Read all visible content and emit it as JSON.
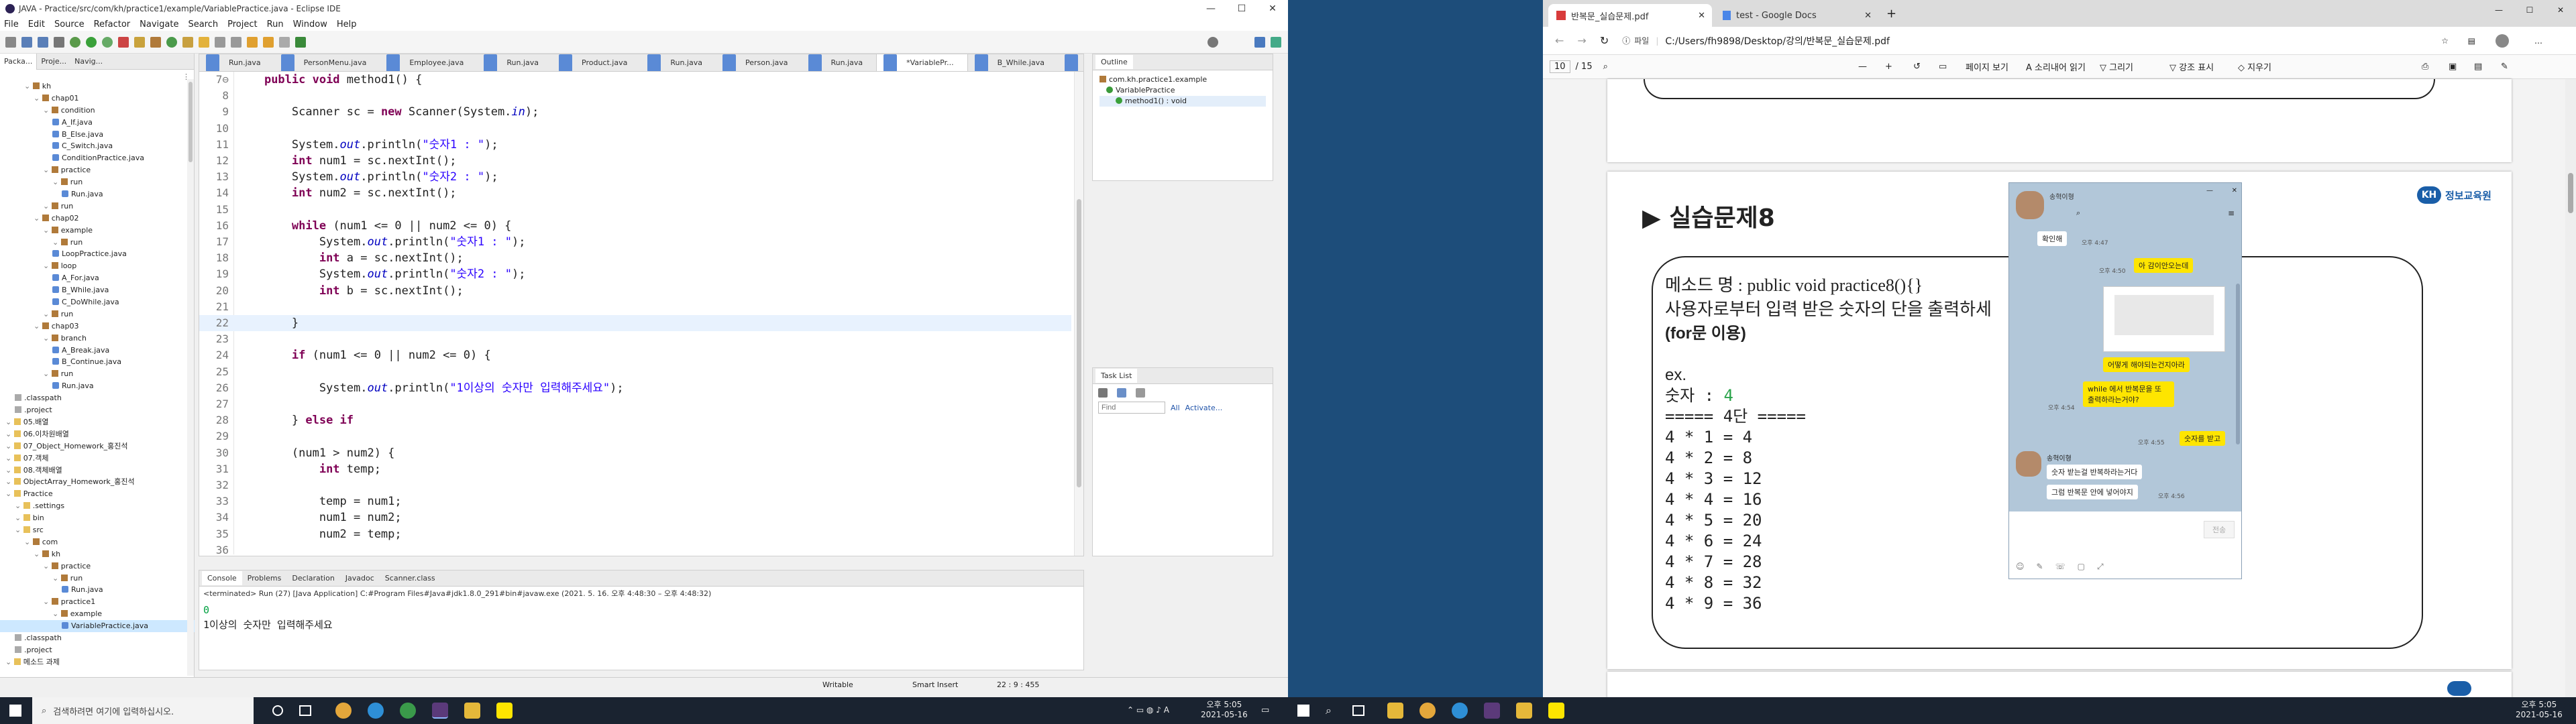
{
  "eclipse": {
    "title": "JAVA - Practice/src/com/kh/practice1/example/VariablePractice.java - Eclipse IDE",
    "window_buttons": {
      "minimize": "—",
      "maximize": "☐",
      "close": "✕"
    },
    "menu": [
      "File",
      "Edit",
      "Source",
      "Refactor",
      "Navigate",
      "Search",
      "Project",
      "Run",
      "Window",
      "Help"
    ],
    "view_tabs": [
      "Packa...",
      "Proje...",
      "Navig..."
    ],
    "tree": [
      {
        "t": "kh",
        "lvl": 2,
        "k": "p"
      },
      {
        "t": "chap01",
        "lvl": 3,
        "k": "p"
      },
      {
        "t": "condition",
        "lvl": 4,
        "k": "p"
      },
      {
        "t": "A_If.java",
        "lvl": 5,
        "k": "j"
      },
      {
        "t": "B_Else.java",
        "lvl": 5,
        "k": "j"
      },
      {
        "t": "C_Switch.java",
        "lvl": 5,
        "k": "j"
      },
      {
        "t": "ConditionPractice.java",
        "lvl": 5,
        "k": "j"
      },
      {
        "t": "practice",
        "lvl": 4,
        "k": "p"
      },
      {
        "t": "run",
        "lvl": 5,
        "k": "p"
      },
      {
        "t": "Run.java",
        "lvl": 6,
        "k": "j"
      },
      {
        "t": "run",
        "lvl": 4,
        "k": "p"
      },
      {
        "t": "chap02",
        "lvl": 3,
        "k": "p"
      },
      {
        "t": "example",
        "lvl": 4,
        "k": "p"
      },
      {
        "t": "run",
        "lvl": 5,
        "k": "p"
      },
      {
        "t": "LoopPractice.java",
        "lvl": 5,
        "k": "j"
      },
      {
        "t": "loop",
        "lvl": 4,
        "k": "p"
      },
      {
        "t": "A_For.java",
        "lvl": 5,
        "k": "j"
      },
      {
        "t": "B_While.java",
        "lvl": 5,
        "k": "j"
      },
      {
        "t": "C_DoWhile.java",
        "lvl": 5,
        "k": "j"
      },
      {
        "t": "run",
        "lvl": 4,
        "k": "p"
      },
      {
        "t": "chap03",
        "lvl": 3,
        "k": "p"
      },
      {
        "t": "branch",
        "lvl": 4,
        "k": "p"
      },
      {
        "t": "A_Break.java",
        "lvl": 5,
        "k": "j"
      },
      {
        "t": "B_Continue.java",
        "lvl": 5,
        "k": "j"
      },
      {
        "t": "run",
        "lvl": 4,
        "k": "p"
      },
      {
        "t": "Run.java",
        "lvl": 5,
        "k": "j"
      },
      {
        "t": ".classpath",
        "lvl": 1,
        "k": "x"
      },
      {
        "t": ".project",
        "lvl": 1,
        "k": "x"
      },
      {
        "t": "05.배열",
        "lvl": 0,
        "k": "f"
      },
      {
        "t": "06.이차원배열",
        "lvl": 0,
        "k": "f"
      },
      {
        "t": "07_Object_Homework_홍진석",
        "lvl": 0,
        "k": "f"
      },
      {
        "t": "07.객체",
        "lvl": 0,
        "k": "f"
      },
      {
        "t": "08.객체배열",
        "lvl": 0,
        "k": "f"
      },
      {
        "t": "ObjectArray_Homework_홍진석",
        "lvl": 0,
        "k": "f"
      },
      {
        "t": "Practice",
        "lvl": 0,
        "k": "f"
      },
      {
        "t": ".settings",
        "lvl": 1,
        "k": "f"
      },
      {
        "t": "bin",
        "lvl": 1,
        "k": "f"
      },
      {
        "t": "src",
        "lvl": 1,
        "k": "f"
      },
      {
        "t": "com",
        "lvl": 2,
        "k": "p"
      },
      {
        "t": "kh",
        "lvl": 3,
        "k": "p"
      },
      {
        "t": "practice",
        "lvl": 4,
        "k": "p"
      },
      {
        "t": "run",
        "lvl": 5,
        "k": "p"
      },
      {
        "t": "Run.java",
        "lvl": 6,
        "k": "j"
      },
      {
        "t": "practice1",
        "lvl": 4,
        "k": "p"
      },
      {
        "t": "example",
        "lvl": 5,
        "k": "p"
      },
      {
        "t": "VariablePractice.java",
        "lvl": 6,
        "k": "j",
        "sel": true
      },
      {
        "t": ".classpath",
        "lvl": 1,
        "k": "x"
      },
      {
        "t": ".project",
        "lvl": 1,
        "k": "x"
      },
      {
        "t": "메소드 과제",
        "lvl": 0,
        "k": "f"
      }
    ],
    "editor_tabs": [
      "Run.java",
      "PersonMenu.java",
      "Employee.java",
      "Run.java",
      "Product.java",
      "Run.java",
      "Person.java",
      "Run.java",
      "*VariablePr...",
      "B_While.java",
      "C_DoWhile.java",
      "»9"
    ],
    "code_lines": [
      {
        "n": "7⊖",
        "h": "    <span class=kw>public void</span> method1() {"
      },
      {
        "n": "8",
        "h": ""
      },
      {
        "n": "9",
        "h": "        Scanner sc = <span class=kw>new</span> Scanner(System.<span class=fi>in</span>);"
      },
      {
        "n": "10",
        "h": ""
      },
      {
        "n": "11",
        "h": "        System.<span class=fi>out</span>.println(<span class=st>\"숫자1 : \"</span>);"
      },
      {
        "n": "12",
        "h": "        <span class=kw>int</span> num1 = sc.nextInt();"
      },
      {
        "n": "13",
        "h": "        System.<span class=fi>out</span>.println(<span class=st>\"숫자2 : \"</span>);"
      },
      {
        "n": "14",
        "h": "        <span class=kw>int</span> num2 = sc.nextInt();"
      },
      {
        "n": "15",
        "h": ""
      },
      {
        "n": "16",
        "h": "        <span class=kw>while</span> (num1 &lt;= 0 || num2 &lt;= 0) {"
      },
      {
        "n": "17",
        "h": "            System.<span class=fi>out</span>.println(<span class=st>\"숫자1 : \"</span>);"
      },
      {
        "n": "18",
        "h": "            <span class=kw>int</span> a = sc.nextInt();"
      },
      {
        "n": "19",
        "h": "            System.<span class=fi>out</span>.println(<span class=st>\"숫자2 : \"</span>);"
      },
      {
        "n": "20",
        "h": "            <span class=kw>int</span> b = sc.nextInt();"
      },
      {
        "n": "21",
        "h": ""
      },
      {
        "n": "22",
        "h": "        }",
        "cur": true
      },
      {
        "n": "23",
        "h": ""
      },
      {
        "n": "24",
        "h": "        <span class=kw>if</span> (num1 &lt;= 0 || num2 &lt;= 0) {"
      },
      {
        "n": "25",
        "h": ""
      },
      {
        "n": "26",
        "h": "            System.<span class=fi>out</span>.println(<span class=st>\"1이상의 숫자만 입력해주세요\"</span>);"
      },
      {
        "n": "27",
        "h": ""
      },
      {
        "n": "28",
        "h": "        } <span class=kw>else if</span>"
      },
      {
        "n": "29",
        "h": ""
      },
      {
        "n": "30",
        "h": "        (num1 &gt; num2) {"
      },
      {
        "n": "31",
        "h": "            <span class=kw>int</span> temp;"
      },
      {
        "n": "32",
        "h": ""
      },
      {
        "n": "33",
        "h": "            temp = num1;"
      },
      {
        "n": "34",
        "h": "            num1 = num2;"
      },
      {
        "n": "35",
        "h": "            num2 = temp;"
      },
      {
        "n": "36",
        "h": ""
      }
    ],
    "outline": {
      "tab": "Outline",
      "items": [
        "com.kh.practice1.example",
        "VariablePractice",
        "method1() : void"
      ]
    },
    "tasklist": {
      "tab": "Task List",
      "find_placeholder": "Find",
      "all": "All",
      "activate": "Activate..."
    },
    "console": {
      "tabs": [
        "Console",
        "Problems",
        "Declaration",
        "Javadoc",
        "Scanner.class"
      ],
      "header": "<terminated> Run (27) [Java Application] C:#Program Files#Java#jdk1.8.0_291#bin#javaw.exe  (2021. 5. 16. 오후 4:48:30 – 오후 4:48:32)",
      "lines": [
        "0",
        "1이상의 숫자만 입력해주세요"
      ]
    },
    "status": {
      "writable": "Writable",
      "insert": "Smart Insert",
      "pos": "22 : 9 : 455"
    }
  },
  "taskbar_left": {
    "search_placeholder": "검색하려면 여기에 입력하십시오.",
    "clock_time": "오후 5:05",
    "clock_date": "2021-05-16"
  },
  "taskbar_right": {
    "clock_time": "오후 5:05",
    "clock_date": "2021-05-16"
  },
  "pdf": {
    "tabs": [
      {
        "title": "반복문_실습문제.pdf"
      },
      {
        "title": "test - Google Docs"
      }
    ],
    "address_label": "파일",
    "address": "C:/Users/fh9898/Desktop/강의/반복문_실습문제.pdf",
    "page_num": "10",
    "page_total": "/ 15",
    "tools": [
      "페이지 보기",
      "소리내어 읽기",
      "그리기",
      "강조 표시",
      "지우기"
    ],
    "heading": "▶ 실습문제8",
    "logo": "정보교육원",
    "method_line": "메소드 명 : public void practice8(){}",
    "desc_line": "사용자로부터 입력 받은 숫자의 단을 출력하세",
    "hint": "(for문 이용)",
    "ex": "ex.",
    "input_label": "숫자 : ",
    "input_value": "4",
    "dan_header": "===== 4단 =====",
    "rows": [
      "4 * 1 = 4",
      "4 * 2 = 8",
      "4 * 3 = 12",
      "4 * 4 = 16",
      "4 * 5 = 20",
      "4 * 6 = 24",
      "4 * 7 = 28",
      "4 * 8 = 32",
      "4 * 9 = 36"
    ]
  },
  "chat": {
    "name1": "송혁이형",
    "messages": [
      {
        "side": "L",
        "text": "확인해",
        "time": "오후 4:47"
      },
      {
        "side": "R",
        "text": "아 감이안오는데",
        "time": "오후 4:50"
      },
      {
        "side": "R",
        "text": "어떻게 해야되는건지아라",
        "time": ""
      },
      {
        "side": "R",
        "text": "while 에서 반복문을 또 출력하라는거야?",
        "time": "오후 4:54"
      },
      {
        "side": "R",
        "text": "숫자를 받고",
        "time": "오후 4:55"
      },
      {
        "side": "L",
        "name": "송혁이형",
        "text": "숫자 받는걸 반복하라는거다",
        "time": ""
      },
      {
        "side": "L",
        "text": "그럼 반복문 안에 넣어야지",
        "time": "오후 4:56"
      }
    ],
    "send_label": "전송"
  }
}
